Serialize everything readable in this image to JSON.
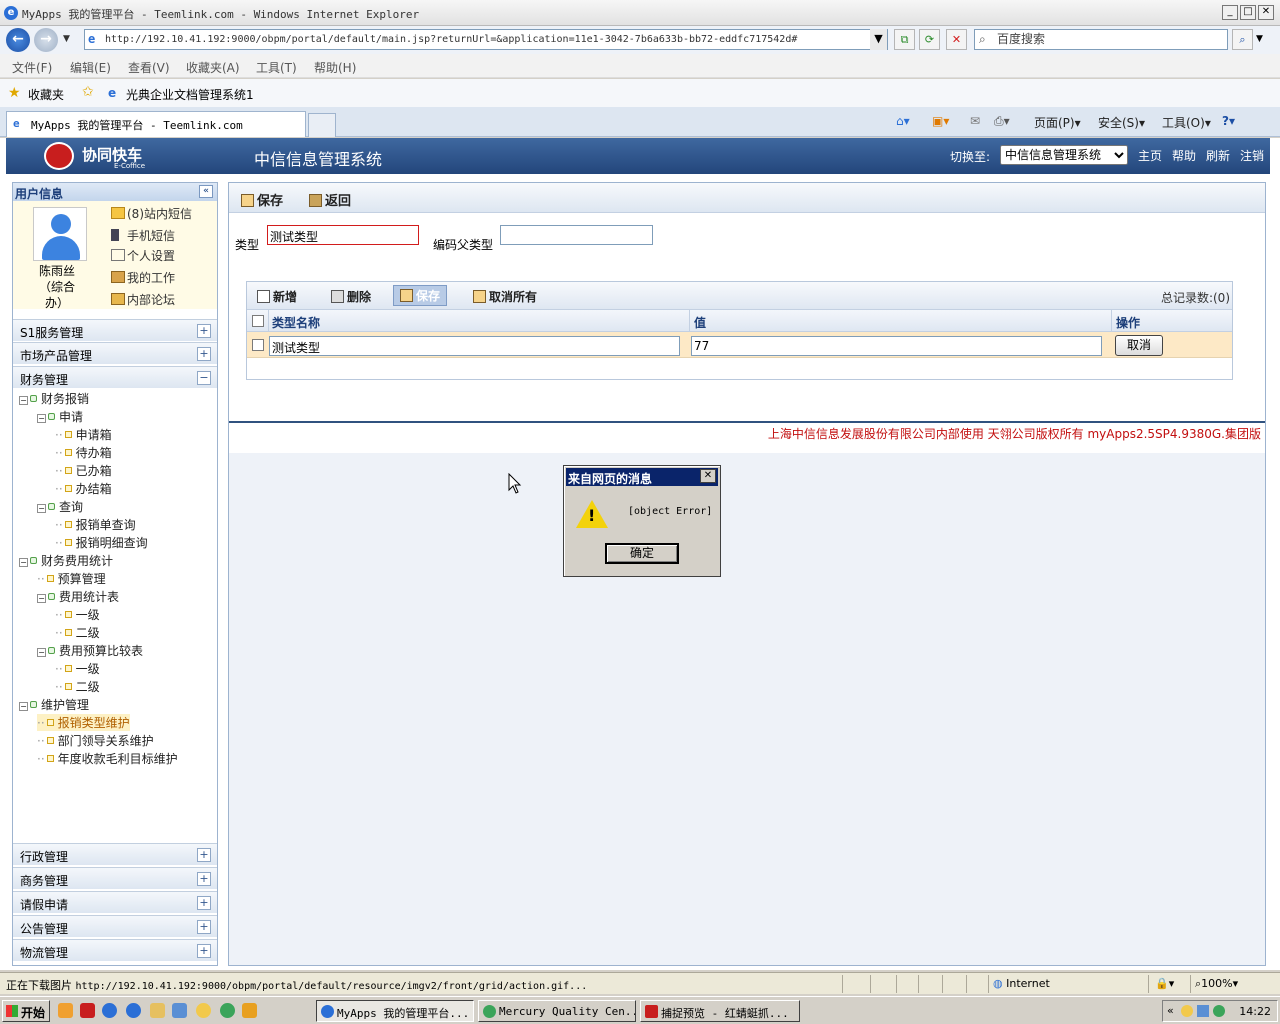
{
  "window": {
    "title": "MyApps 我的管理平台 - Teemlink.com - Windows Internet Explorer",
    "address": "http://192.10.41.192:9000/obpm/portal/default/main.jsp?returnUrl=&application=11e1-3042-7b6a633b-bb72-eddfc717542d#",
    "search_placeholder": "百度搜索"
  },
  "menu": [
    "文件(F)",
    "编辑(E)",
    "查看(V)",
    "收藏夹(A)",
    "工具(T)",
    "帮助(H)"
  ],
  "favorites": {
    "label": "收藏夹",
    "item": "光典企业文档管理系统1"
  },
  "tab": {
    "title": "MyApps 我的管理平台 - Teemlink.com"
  },
  "ie_toolbar": {
    "page": "页面(P)",
    "safety": "安全(S)",
    "tools": "工具(O)"
  },
  "app": {
    "brand": "协同快车",
    "brand_sub": "E-Coffice",
    "system_title": "中信信息管理系统",
    "switch_label": "切换至:",
    "switch_value": "中信信息管理系统",
    "links": [
      "主页",
      "帮助",
      "刷新",
      "注销"
    ]
  },
  "user": {
    "header": "用户信息",
    "name": "陈雨丝（综合办）",
    "name_lines": [
      "陈雨丝",
      "（综合",
      "办）"
    ],
    "links": [
      "(8)站内短信",
      "手机短信",
      "个人设置",
      "我的工作",
      "内部论坛"
    ]
  },
  "nav": {
    "top_sections": [
      "S1服务管理",
      "市场产品管理",
      "财务管理"
    ],
    "tree": [
      {
        "label": "财务报销",
        "kind": "folder",
        "level": 0
      },
      {
        "label": "申请",
        "kind": "folder",
        "level": 1
      },
      {
        "label": "申请箱",
        "kind": "leaf",
        "level": 2
      },
      {
        "label": "待办箱",
        "kind": "leaf",
        "level": 2
      },
      {
        "label": "已办箱",
        "kind": "leaf",
        "level": 2
      },
      {
        "label": "办结箱",
        "kind": "leaf",
        "level": 2
      },
      {
        "label": "查询",
        "kind": "folder",
        "level": 1
      },
      {
        "label": "报销单查询",
        "kind": "leaf",
        "level": 2
      },
      {
        "label": "报销明细查询",
        "kind": "leaf",
        "level": 2
      },
      {
        "label": "财务费用统计",
        "kind": "folder",
        "level": 0
      },
      {
        "label": "预算管理",
        "kind": "leaf",
        "level": 1
      },
      {
        "label": "费用统计表",
        "kind": "folder",
        "level": 1
      },
      {
        "label": "一级",
        "kind": "leaf",
        "level": 2
      },
      {
        "label": "二级",
        "kind": "leaf",
        "level": 2
      },
      {
        "label": "费用预算比较表",
        "kind": "folder",
        "level": 1
      },
      {
        "label": "一级",
        "kind": "leaf",
        "level": 2
      },
      {
        "label": "二级",
        "kind": "leaf",
        "level": 2
      },
      {
        "label": "维护管理",
        "kind": "folder",
        "level": 0
      },
      {
        "label": "报销类型维护",
        "kind": "leaf",
        "level": 1,
        "selected": true
      },
      {
        "label": "部门领导关系维护",
        "kind": "leaf",
        "level": 1
      },
      {
        "label": "年度收款毛利目标维护",
        "kind": "leaf",
        "level": 1
      }
    ],
    "bottom_sections": [
      "行政管理",
      "商务管理",
      "请假申请",
      "公告管理",
      "物流管理"
    ]
  },
  "form": {
    "save": "保存",
    "back": "返回",
    "type_label": "类型",
    "type_value": "测试类型",
    "parent_label": "编码父类型",
    "parent_value": ""
  },
  "grid": {
    "toolbar": {
      "add": "新增",
      "delete": "删除",
      "save": "保存",
      "cancel_all": "取消所有"
    },
    "record_count": "总记录数:(0)",
    "columns": [
      "类型名称",
      "值",
      "操作"
    ],
    "rows": [
      {
        "name": "测试类型",
        "value": "77",
        "action": "取消"
      }
    ]
  },
  "copyright": "上海中信信息发展股份有限公司内部使用  天翎公司版权所有  myApps2.5SP4.9380G.集团版",
  "dialog": {
    "title": "来自网页的消息",
    "message": "[object Error]",
    "ok": "确定"
  },
  "status": {
    "text": "正在下载图片",
    "url": "http://192.10.41.192:9000/obpm/portal/default/resource/imgv2/front/grid/action.gif...",
    "zone": "Internet",
    "zoom": "100%"
  },
  "taskbar": {
    "start": "开始",
    "tasks": [
      "MyApps 我的管理平台...",
      "Mercury Quality Cen...",
      "捕捉预览 - 红蜻蜓抓..."
    ],
    "clock": "14:22"
  },
  "colors": {
    "header_blue": "#2c4f86",
    "error_red": "#d21c1c",
    "row_highlight": "#fde9c6"
  }
}
